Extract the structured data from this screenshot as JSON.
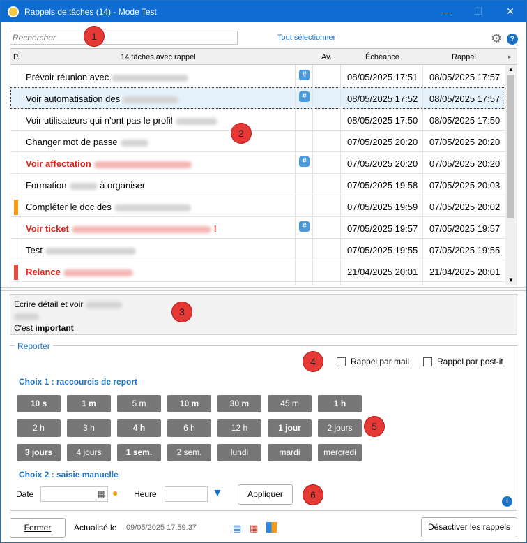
{
  "window": {
    "title": "Rappels de tâches (14) - Mode Test",
    "minimize": "—",
    "maximize": "☐",
    "close": "✕"
  },
  "markers": [
    "1",
    "2",
    "3",
    "4",
    "5",
    "6"
  ],
  "toolbar": {
    "search_placeholder": "Rechercher",
    "select_all": "Tout sélectionner",
    "settings_icon": "gear-icon",
    "help_label": "?"
  },
  "table": {
    "columns": {
      "priority": "P.",
      "task": "14 tâches avec rappel",
      "notice": "Av.",
      "due": "Échéance",
      "reminder": "Rappel"
    },
    "rows": [
      {
        "text": "Prévoir réunion avec",
        "hash": true,
        "due": "08/05/2025 17:51",
        "reminder": "08/05/2025 17:57"
      },
      {
        "text": "Voir automatisation des",
        "hash": true,
        "due": "08/05/2025 17:52",
        "reminder": "08/05/2025 17:57"
      },
      {
        "text": "Voir utilisateurs qui n'ont pas le profil",
        "hash": false,
        "due": "08/05/2025 17:50",
        "reminder": "08/05/2025 17:50"
      },
      {
        "text": "Changer mot de passe",
        "hash": false,
        "due": "07/05/2025 20:20",
        "reminder": "07/05/2025 20:20"
      },
      {
        "text": "Voir affectation",
        "hash": true,
        "due": "07/05/2025 20:20",
        "reminder": "07/05/2025 20:20"
      },
      {
        "text": "Formation",
        "suffix": "à organiser",
        "hash": false,
        "due": "07/05/2025 19:58",
        "reminder": "07/05/2025 20:03"
      },
      {
        "text": "Compléter le doc des",
        "hash": false,
        "due": "07/05/2025 19:59",
        "reminder": "07/05/2025 20:02"
      },
      {
        "text": "Voir ticket",
        "suffix": "!",
        "hash": true,
        "due": "07/05/2025 19:57",
        "reminder": "07/05/2025 19:57"
      },
      {
        "text": "Test",
        "hash": false,
        "due": "07/05/2025 19:55",
        "reminder": "07/05/2025 19:55"
      },
      {
        "text": "Relance",
        "hash": false,
        "due": "21/04/2025 20:01",
        "reminder": "21/04/2025 20:01"
      }
    ],
    "hash_symbol": "#"
  },
  "detail": {
    "line1": "Ecrire détail et voir",
    "line3_prefix": "C'est ",
    "line3_bold": "important"
  },
  "report": {
    "legend": "Reporter",
    "mail_label": "Rappel par mail",
    "postit_label": "Rappel par post-it",
    "choice1": "Choix 1 : raccourcis de report",
    "choice2": "Choix 2 : saisie manuelle",
    "shortcuts": [
      [
        "10 s",
        "1 m",
        "5 m",
        "10 m",
        "30 m",
        "45 m",
        "1 h"
      ],
      [
        "2 h",
        "3 h",
        "4 h",
        "6 h",
        "12 h",
        "1 jour",
        "2 jours"
      ],
      [
        "3 jours",
        "4 jours",
        "1 sem.",
        "2 sem.",
        "lundi",
        "mardi",
        "mercredi"
      ]
    ],
    "date_label": "Date",
    "time_label": "Heure",
    "apply": "Appliquer",
    "info_label": "i"
  },
  "footer": {
    "close": "Fermer",
    "updated_label": "Actualisé le",
    "updated_value": "09/05/2025 17:59:37",
    "disable": "Désactiver les rappels"
  },
  "colors": {
    "accent": "#0f6cd1",
    "red_text": "#e0241a",
    "flag_orange": "#f39c12",
    "flag_red": "#e74c3c",
    "button_gray": "#777777"
  }
}
